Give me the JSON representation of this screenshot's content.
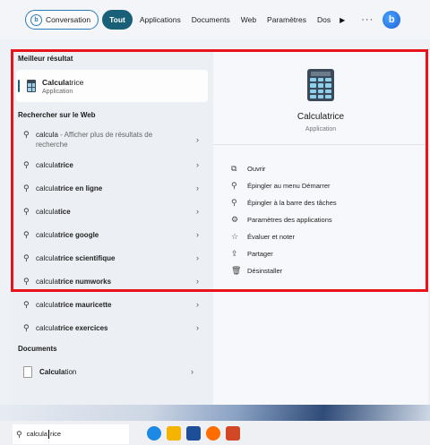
{
  "filters": {
    "conversation": "Conversation",
    "tabs": [
      "Tout",
      "Applications",
      "Documents",
      "Web",
      "Paramètres",
      "Dos"
    ],
    "more": "···",
    "bing": "b"
  },
  "left": {
    "best_title": "Meilleur résultat",
    "best_name_bold": "Calcula",
    "best_name_rest": "trice",
    "best_sub": "Application",
    "web_title": "Rechercher sur le Web",
    "web_first_base": "calcula",
    "web_first_more": " - Afficher plus de résultats de recherche",
    "suggestions": [
      {
        "base": "calcula",
        "bold": "trice"
      },
      {
        "base": "calcula",
        "bold": "trice en ligne"
      },
      {
        "base": "calcula",
        "bold": "tice"
      },
      {
        "base": "calcula",
        "bold": "trice google"
      },
      {
        "base": "calcula",
        "bold": "trice scientifique"
      },
      {
        "base": "calcula",
        "bold": "trice numworks"
      },
      {
        "base": "calcula",
        "bold": "trice mauricette"
      },
      {
        "base": "calcula",
        "bold": "trice exercices"
      }
    ],
    "docs_title": "Documents",
    "doc_bold": "Calcula",
    "doc_rest": "tion"
  },
  "right": {
    "app_name": "Calculatrice",
    "app_type": "Application",
    "actions": [
      {
        "icon": "open-icon",
        "glyph": "⧉",
        "label": "Ouvrir"
      },
      {
        "icon": "pin-icon",
        "glyph": "⚲",
        "label": "Épingler au menu Démarrer"
      },
      {
        "icon": "pin-icon",
        "glyph": "⚲",
        "label": "Épingler à la barre des tâches"
      },
      {
        "icon": "settings-icon",
        "glyph": "⚙",
        "label": "Paramètres des applications"
      },
      {
        "icon": "star-icon",
        "glyph": "☆",
        "label": "Évaluer et noter"
      },
      {
        "icon": "share-icon",
        "glyph": "⇪",
        "label": "Partager"
      },
      {
        "icon": "trash-icon",
        "glyph": "🗑",
        "label": "Désinstaller"
      }
    ]
  },
  "taskbar": {
    "search_before_caret": "calcula",
    "search_after_caret": "rice"
  },
  "colors": {
    "accent": "#1a5f78",
    "highlight_frame": "#e8131b"
  }
}
